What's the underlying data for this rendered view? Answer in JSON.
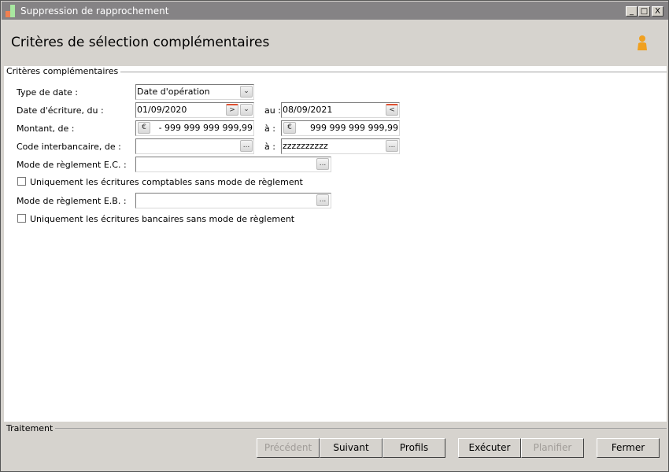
{
  "window": {
    "title": "Suppression de rapprochement",
    "min": "_",
    "max": "□",
    "close": "X"
  },
  "header": {
    "title": "Critères de sélection complémentaires"
  },
  "section": {
    "title": "Critères complémentaires"
  },
  "form": {
    "type_date": {
      "label": "Type de date :",
      "value": "Date d'opération"
    },
    "date_ecriture": {
      "label": "Date d'écriture, du :",
      "from": "01/09/2020",
      "to_label": "au :",
      "to": "08/09/2021"
    },
    "montant": {
      "label": "Montant, de :",
      "from": "- 999 999 999 999,99",
      "to_label": "à :",
      "to": "999 999 999 999,99"
    },
    "code_interbancaire": {
      "label": "Code interbancaire, de :",
      "from": "",
      "to_label": "à :",
      "to": "zzzzzzzzzz"
    },
    "mode_ec": {
      "label": "Mode de règlement E.C. :",
      "value": ""
    },
    "check_ec": {
      "label": "Uniquement les écritures comptables sans mode de règlement",
      "checked": false
    },
    "mode_eb": {
      "label": "Mode de règlement E.B. :",
      "value": ""
    },
    "check_eb": {
      "label": "Uniquement les écritures bancaires sans mode de règlement",
      "checked": false
    }
  },
  "footer": {
    "section": "Traitement",
    "buttons": {
      "precedent": "Précédent",
      "suivant": "Suivant",
      "profils": "Profils",
      "executer": "Exécuter",
      "planifier": "Planifier",
      "fermer": "Fermer"
    }
  },
  "icons": {
    "ellipsis": "...",
    "euro": "€",
    "down": "⌄",
    "next": ">",
    "prev": "<"
  }
}
